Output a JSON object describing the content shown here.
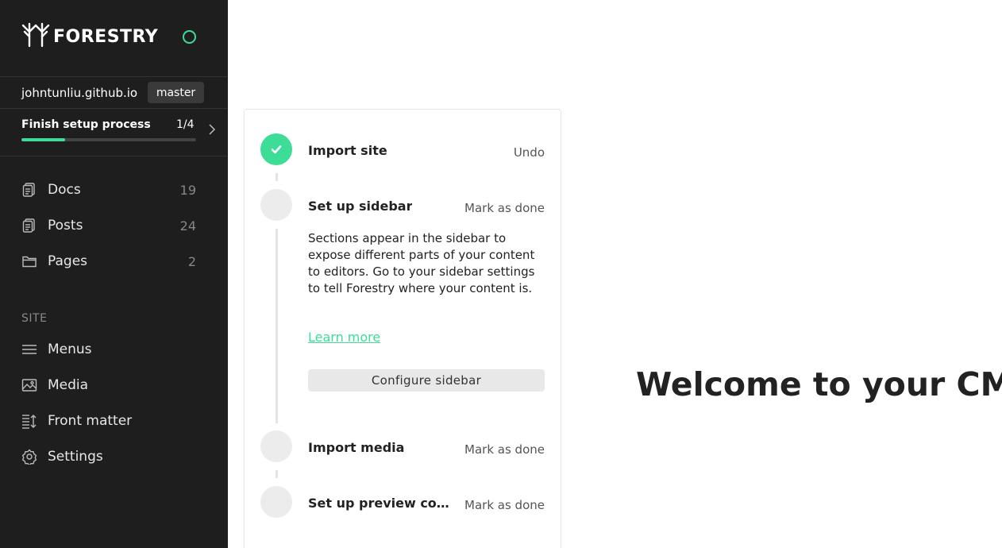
{
  "brand": {
    "name": "FORESTRY",
    "logo_icon": "forestry-tree-logo",
    "status_color": "#3ddc97"
  },
  "repo": {
    "name": "johntunliu.github.io",
    "branch": "master"
  },
  "setup": {
    "title": "Finish setup process",
    "count": "1/4",
    "progress": 0.25,
    "chevron_icon": "chevron-right-icon"
  },
  "nav": {
    "content": [
      {
        "label": "Docs",
        "count": "19",
        "icon": "document-icon"
      },
      {
        "label": "Posts",
        "count": "24",
        "icon": "document-icon"
      },
      {
        "label": "Pages",
        "count": "2",
        "icon": "folder-icon"
      }
    ],
    "site_label": "SITE",
    "site": [
      {
        "label": "Menus",
        "icon": "menu-icon"
      },
      {
        "label": "Media",
        "icon": "image-icon"
      },
      {
        "label": "Front matter",
        "icon": "sort-list-icon"
      },
      {
        "label": "Settings",
        "icon": "gear-icon"
      }
    ]
  },
  "checklist": {
    "steps": [
      {
        "title": "Import site",
        "action": "Undo",
        "done": true
      },
      {
        "title": "Set up sidebar",
        "action": "Mark as done",
        "done": false
      },
      {
        "title": "Import media",
        "action": "Mark as done",
        "done": false
      },
      {
        "title": "Set up preview com...",
        "action": "Mark as done",
        "done": false
      }
    ],
    "sidebar_description": "Sections appear in the sidebar to expose different parts of your content to editors. Go to your sidebar settings to tell Forestry where your content is.",
    "learn_more": "Learn more",
    "configure_button": "Configure sidebar"
  },
  "main": {
    "welcome": "Welcome to your CMS!"
  },
  "colors": {
    "accent": "#3ddc97",
    "sidebar_bg": "#1e1e1e"
  }
}
